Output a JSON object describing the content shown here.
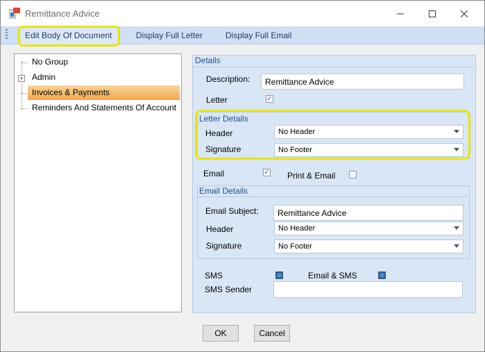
{
  "window": {
    "title": "Remittance Advice"
  },
  "toolbar": {
    "edit_body": "Edit Body Of Document",
    "display_letter": "Display Full Letter",
    "display_email": "Display Full Email"
  },
  "tree": {
    "items": [
      "No Group",
      "Admin",
      "Invoices & Payments",
      "Reminders And Statements Of Account"
    ],
    "selected": "Invoices & Payments"
  },
  "details": {
    "heading": "Details",
    "description_label": "Description:",
    "description_value": "Remittance Advice",
    "letter_label": "Letter",
    "letter_checked": true
  },
  "letter_details": {
    "heading": "Letter Details",
    "header_label": "Header",
    "header_value": "No Header",
    "signature_label": "Signature",
    "signature_value": "No Footer"
  },
  "email": {
    "email_label": "Email",
    "email_checked": true,
    "print_email_label": "Print & Email",
    "print_email_checked": false
  },
  "email_details": {
    "heading": "Email Details",
    "subject_label": "Email Subject:",
    "subject_value": "Remittance Advice",
    "header_label": "Header",
    "header_value": "No Header",
    "signature_label": "Signature",
    "signature_value": "No Footer"
  },
  "sms": {
    "sms_label": "SMS",
    "email_sms_label": "Email & SMS",
    "sender_label": "SMS Sender",
    "sender_value": ""
  },
  "buttons": {
    "ok": "OK",
    "cancel": "Cancel"
  },
  "colors": {
    "toolbar_bg": "#cfe0f5",
    "panel_bg": "#d9e6f5",
    "selection": "#f6a647",
    "highlight": "#e9e600"
  }
}
